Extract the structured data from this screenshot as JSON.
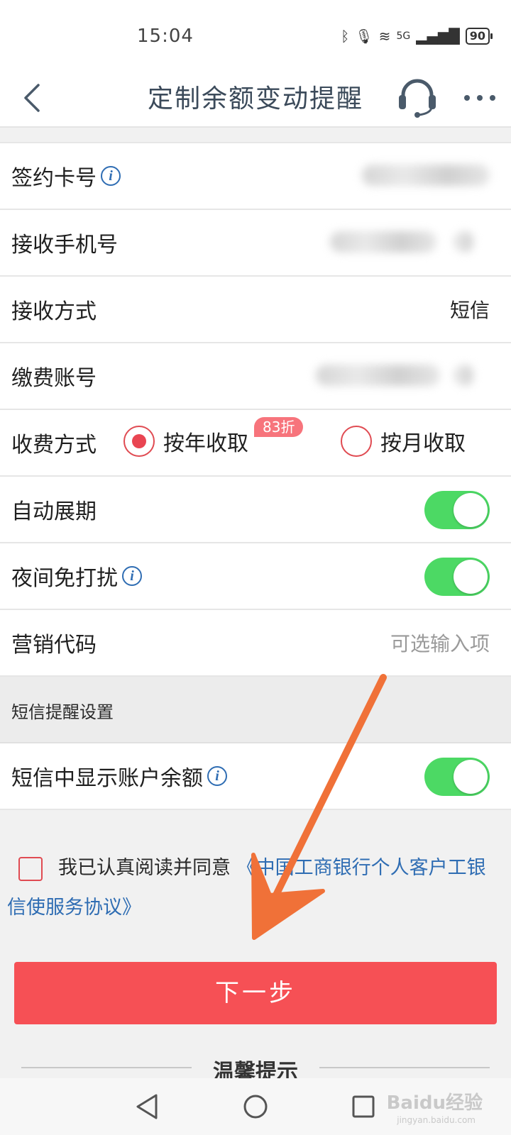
{
  "status": {
    "time": "15:04",
    "signal": "5G",
    "battery": "90"
  },
  "header": {
    "title": "定制余额变动提醒"
  },
  "form": {
    "card_label": "签约卡号",
    "phone_label": "接收手机号",
    "method_label": "接收方式",
    "method_value": "短信",
    "pay_account_label": "缴费账号",
    "fee_label": "收费方式",
    "fee_yearly": "按年收取",
    "fee_discount": "83折",
    "fee_monthly": "按月收取",
    "auto_renew_label": "自动展期",
    "auto_renew_on": true,
    "night_label": "夜间免打扰",
    "night_on": true,
    "marketing_label": "营销代码",
    "marketing_placeholder": "可选输入项"
  },
  "sms_section": {
    "title": "短信提醒设置",
    "show_balance_label": "短信中显示账户余额",
    "show_balance_on": true
  },
  "agreement": {
    "text": "我已认真阅读并同意",
    "link": "《中国工商银行个人客户工银信使服务协议》",
    "checked": false
  },
  "next_button": "下一步",
  "tips_title": "温馨提示",
  "watermark": {
    "text": "Baidu经验",
    "sub": "jingyan.baidu.com"
  },
  "colors": {
    "accent": "#f65055",
    "link": "#2f6db3",
    "toggle": "#4cd964",
    "arrow": "#f07138"
  }
}
